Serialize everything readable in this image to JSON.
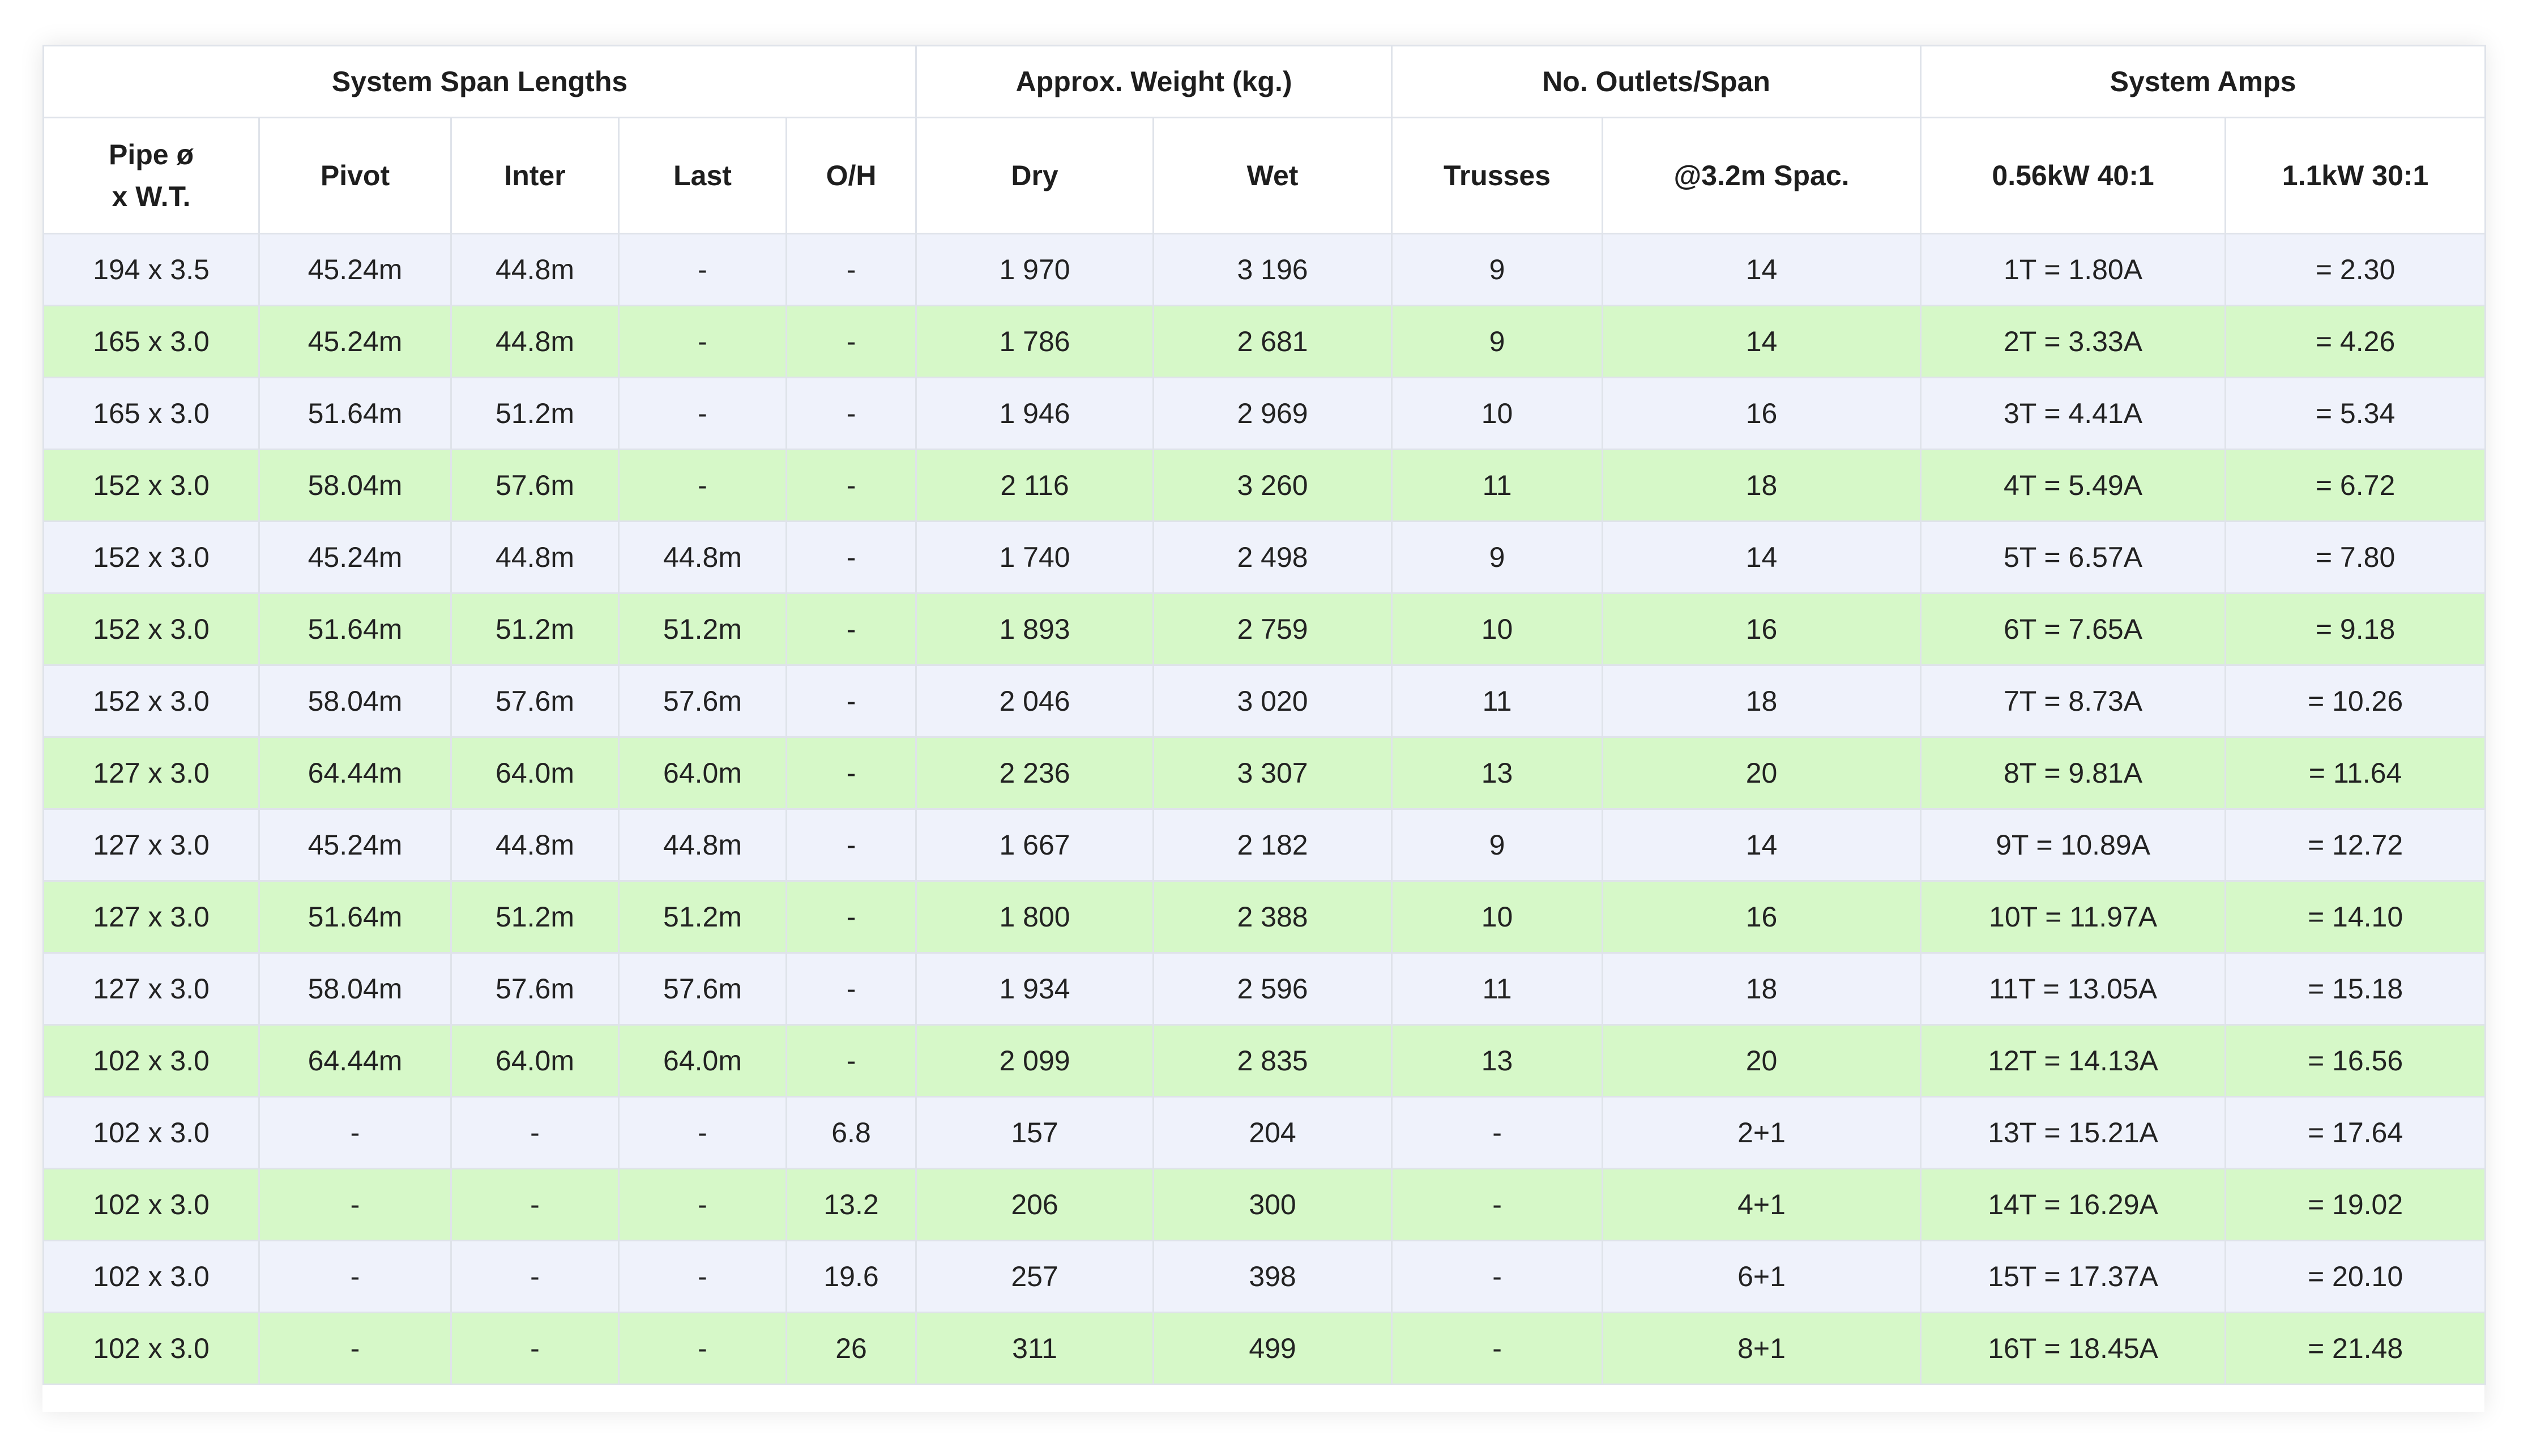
{
  "groups": [
    {
      "label": "System Span Lengths",
      "span": 5
    },
    {
      "label": "Approx. Weight (kg.)",
      "span": 2
    },
    {
      "label": "No. Outlets/Span",
      "span": 2
    },
    {
      "label": "System Amps",
      "span": 2
    }
  ],
  "columns": [
    "Pipe ø\nx W.T.",
    "Pivot",
    "Inter",
    "Last",
    "O/H",
    "Dry",
    "Wet",
    "Trusses",
    "@3.2m Spac.",
    "0.56kW 40:1",
    "1.1kW 30:1"
  ],
  "rows": [
    [
      "194 x 3.5",
      "45.24m",
      "44.8m",
      "-",
      "-",
      "1 970",
      "3 196",
      "9",
      "14",
      "1T = 1.80A",
      "= 2.30"
    ],
    [
      "165 x 3.0",
      "45.24m",
      "44.8m",
      "-",
      "-",
      "1 786",
      "2 681",
      "9",
      "14",
      "2T = 3.33A",
      "= 4.26"
    ],
    [
      "165 x 3.0",
      "51.64m",
      "51.2m",
      "-",
      "-",
      "1 946",
      "2 969",
      "10",
      "16",
      "3T = 4.41A",
      "= 5.34"
    ],
    [
      "152 x 3.0",
      "58.04m",
      "57.6m",
      "-",
      "-",
      "2 116",
      "3 260",
      "11",
      "18",
      "4T = 5.49A",
      "= 6.72"
    ],
    [
      "152 x 3.0",
      "45.24m",
      "44.8m",
      "44.8m",
      "-",
      "1 740",
      "2 498",
      "9",
      "14",
      "5T = 6.57A",
      "= 7.80"
    ],
    [
      "152 x 3.0",
      "51.64m",
      "51.2m",
      "51.2m",
      "-",
      "1 893",
      "2 759",
      "10",
      "16",
      "6T = 7.65A",
      "= 9.18"
    ],
    [
      "152 x 3.0",
      "58.04m",
      "57.6m",
      "57.6m",
      "-",
      "2 046",
      "3 020",
      "11",
      "18",
      "7T = 8.73A",
      "= 10.26"
    ],
    [
      "127 x 3.0",
      "64.44m",
      "64.0m",
      "64.0m",
      "-",
      "2 236",
      "3 307",
      "13",
      "20",
      "8T = 9.81A",
      "= 11.64"
    ],
    [
      "127 x 3.0",
      "45.24m",
      "44.8m",
      "44.8m",
      "-",
      "1 667",
      "2 182",
      "9",
      "14",
      "9T = 10.89A",
      "= 12.72"
    ],
    [
      "127 x 3.0",
      "51.64m",
      "51.2m",
      "51.2m",
      "-",
      "1 800",
      "2 388",
      "10",
      "16",
      "10T = 11.97A",
      "= 14.10"
    ],
    [
      "127 x 3.0",
      "58.04m",
      "57.6m",
      "57.6m",
      "-",
      "1 934",
      "2 596",
      "11",
      "18",
      "11T = 13.05A",
      "= 15.18"
    ],
    [
      "102 x 3.0",
      "64.44m",
      "64.0m",
      "64.0m",
      "-",
      "2 099",
      "2 835",
      "13",
      "20",
      "12T = 14.13A",
      "= 16.56"
    ],
    [
      "102 x 3.0",
      "-",
      "-",
      "-",
      "6.8",
      "157",
      "204",
      "-",
      "2+1",
      "13T = 15.21A",
      "= 17.64"
    ],
    [
      "102 x 3.0",
      "-",
      "-",
      "-",
      "13.2",
      "206",
      "300",
      "-",
      "4+1",
      "14T = 16.29A",
      "= 19.02"
    ],
    [
      "102 x 3.0",
      "-",
      "-",
      "-",
      "19.6",
      "257",
      "398",
      "-",
      "6+1",
      "15T = 17.37A",
      "= 20.10"
    ],
    [
      "102 x 3.0",
      "-",
      "-",
      "-",
      "26",
      "311",
      "499",
      "-",
      "8+1",
      "16T = 18.45A",
      "= 21.48"
    ]
  ],
  "colors": {
    "row_odd": "#eff2fb",
    "row_even": "#d6f8c8",
    "grid": "#dfe3ea",
    "text": "#222222"
  }
}
